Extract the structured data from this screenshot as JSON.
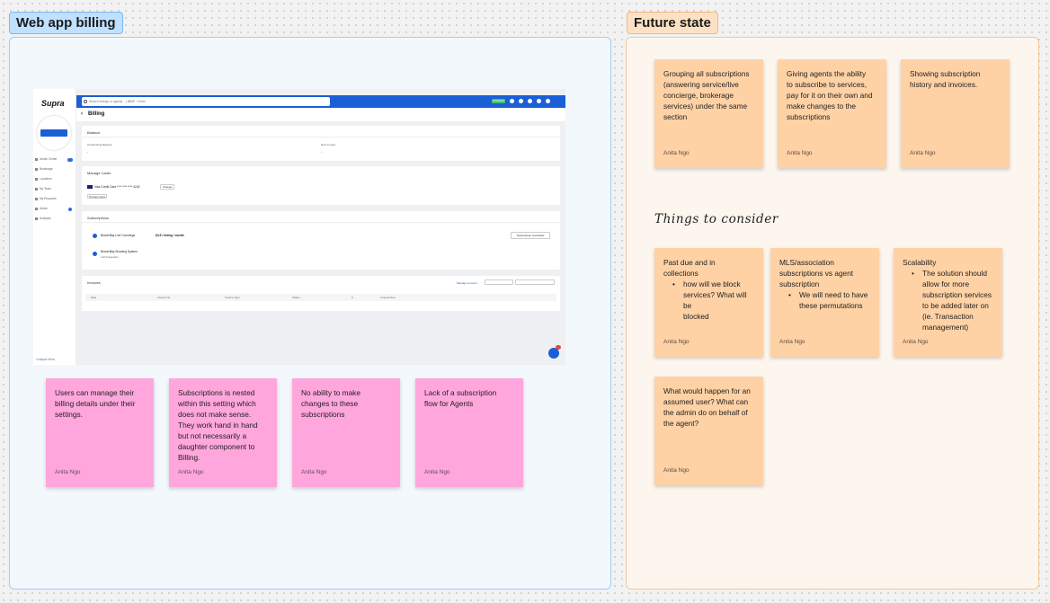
{
  "sections": {
    "left_title": "Web app billing",
    "right_title": "Future state"
  },
  "app_screenshot": {
    "logo": "Supra",
    "sidebar": [
      {
        "label": "Admin Center",
        "icon": "grid-icon",
        "badge": "28"
      },
      {
        "label": "Brokerage",
        "icon": "building-icon"
      },
      {
        "label": "Locations",
        "icon": "location-icon"
      },
      {
        "label": "My Team",
        "icon": "team-icon"
      },
      {
        "label": "My Requests",
        "icon": "heart-icon"
      },
      {
        "label": "Admin",
        "icon": "wrench-icon",
        "badge": "2"
      },
      {
        "label": "Analytics",
        "icon": "chart-icon"
      }
    ],
    "collapse_label": "Collapse Menu",
    "search_placeholder": "Search listings or agents... | ⌘MP + Enter",
    "plan_badge": "UPGRADE",
    "page_title": "Billing",
    "balance": {
      "heading": "Balance",
      "outstanding_label": "Outstanding Balance",
      "outstanding_value": "-",
      "next_invoice_label": "Next invoice",
      "next_invoice_value": "-"
    },
    "manage_cards": {
      "heading": "Manage Cards",
      "card_text": "Visa Credit Card  **** **** **** 4242",
      "change_label": "Change",
      "primary_label": "Primary Card"
    },
    "subscriptions": {
      "heading": "Subscriptions",
      "items": [
        {
          "name": "BrokerBay Live Concierge",
          "price": "$4.5 / listing / month",
          "action": "Subscription Cancelled"
        },
        {
          "name": "BrokerBay Showing System",
          "sub": "Full Integration"
        }
      ]
    },
    "invoices": {
      "heading": "Invoices",
      "manage_link": "Manage Invoices",
      "columns": [
        "Date",
        "Invoice No.",
        "Invoice Type",
        "Status",
        "#",
        "Amount Due"
      ]
    }
  },
  "left_stickies": [
    {
      "text": "Users can manage their\nbilling details under their\nsettings.",
      "author": "Anita Ngo"
    },
    {
      "text": "Subscriptions is nested\nwithin this setting which\ndoes not make sense.\nThey work hand in hand\nbut not necessarily a\ndaughter component to\nBilling.",
      "author": "Anita Ngo"
    },
    {
      "text": "No ability to make\nchanges to these\nsubscriptions",
      "author": "Anita Ngo"
    },
    {
      "text": "Lack of a subscription\nflow for Agents",
      "author": "Anita Ngo"
    }
  ],
  "future_stickies": [
    {
      "text": "Grouping all subscriptions\n(answering service/live\nconcierge, brokerage\nservices) under the same\nsection",
      "author": "Anita Ngo"
    },
    {
      "text": "Giving agents the ability\nto subscribe to services,\npay for it on their own and\nmake changes to the\nsubscriptions",
      "author": "Anita Ngo"
    },
    {
      "text": "Showing subscription\nhistory and invoices.",
      "author": "Anita Ngo"
    }
  ],
  "consider_heading": "Things to consider",
  "consider_stickies": [
    {
      "title": "Past due and in\ncollections",
      "bullet": "how will we block\nservices? What will be\nblocked",
      "author": "Anita Ngo"
    },
    {
      "title": "MLS/association\nsubscriptions vs agent\nsubscription",
      "bullet": "We will need to have\nthese permutations",
      "author": "Anita Ngo"
    },
    {
      "title": "Scalability",
      "bullet": "The solution should\nallow for more\nsubscription services\nto be added later on\n(ie. Transaction\nmanagement)",
      "author": "Anita Ngo"
    },
    {
      "title": "What would happen for an\nassumed user? What can\nthe admin do on behalf of\nthe agent?",
      "author": "Anita Ngo"
    }
  ]
}
